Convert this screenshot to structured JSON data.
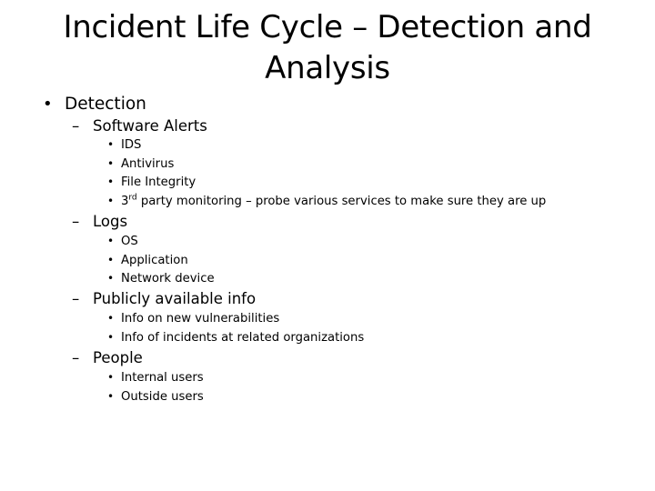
{
  "slide": {
    "title": "Incident Life Cycle – Detection and Analysis",
    "title_line1": "Incident Life Cycle – Detection and",
    "title_line2": "Analysis",
    "bullet_marker": "•",
    "dash_marker": "–",
    "top_item": {
      "label": "Detection",
      "sections": [
        {
          "label": "Software Alerts",
          "items": [
            "IDS",
            "Antivirus",
            "File Integrity",
            {
              "prefix": "3",
              "sup": "rd",
              "rest": " party monitoring – probe various services to make sure they are up"
            }
          ]
        },
        {
          "label": "Logs",
          "items": [
            "OS",
            "Application",
            "Network device"
          ]
        },
        {
          "label": "Publicly available info",
          "items": [
            "Info on new vulnerabilities",
            "Info of incidents at related organizations"
          ]
        },
        {
          "label": "People",
          "items": [
            "Internal users",
            "Outside users"
          ]
        }
      ]
    }
  }
}
